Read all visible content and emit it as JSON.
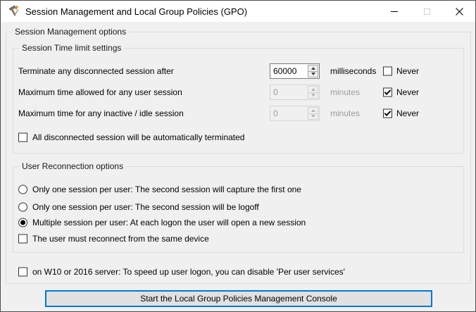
{
  "window": {
    "title": "Session Management and Local Group Policies (GPO)"
  },
  "groups": {
    "outer_label": "Session Management options",
    "time_limits_label": "Session Time limit settings",
    "reconnection_label": "User Reconnection options"
  },
  "time_limits": {
    "never_label": "Never",
    "rows": [
      {
        "label": "Terminate any disconnected session after",
        "value": "60000",
        "unit": "milliseconds",
        "never_checked": false,
        "enabled": true
      },
      {
        "label": "Maximum time allowed for any user session",
        "value": "0",
        "unit": "minutes",
        "never_checked": true,
        "enabled": false
      },
      {
        "label": "Maximum time for any inactive / idle session",
        "value": "0",
        "unit": "minutes",
        "never_checked": true,
        "enabled": false
      }
    ],
    "auto_terminate": {
      "label": "All disconnected session will be automatically terminated",
      "checked": false
    }
  },
  "reconnection": {
    "options": [
      {
        "type": "radio",
        "label": "Only one session per user: The second session will capture the first one",
        "selected": false
      },
      {
        "type": "radio",
        "label": "Only one session per user: The second session will be logoff",
        "selected": false
      },
      {
        "type": "radio",
        "label": "Multiple session per user: At each logon the user will open a new session",
        "selected": true
      },
      {
        "type": "checkbox",
        "label": "The user must reconnect from the same device",
        "checked": false
      }
    ]
  },
  "w10_option": {
    "label": "on W10 or 2016 server: To speed up user logon, you can disable 'Per user services'",
    "checked": false
  },
  "start_button_label": "Start the Local Group Policies Management Console",
  "colors": {
    "accent": "#0078d7",
    "titlebar_bg": "#ffffff",
    "client_bg": "#f0f0f0",
    "groupbox_border": "#dcdcdc",
    "disabled_text": "#9b9b9b",
    "button_bg": "#e1e1e1"
  }
}
